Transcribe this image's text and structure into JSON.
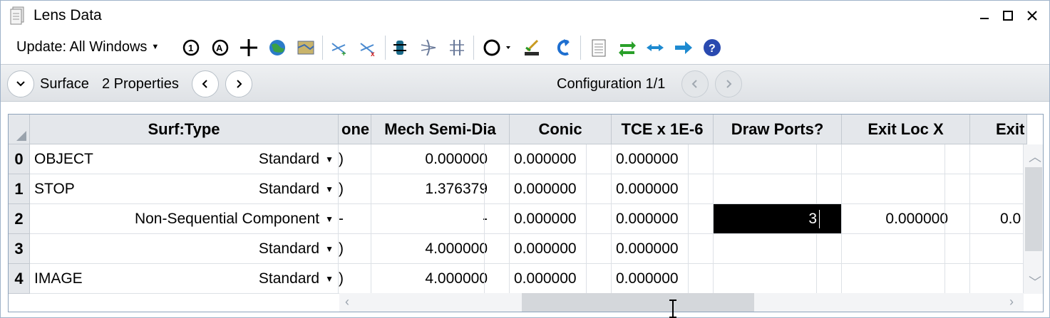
{
  "window": {
    "title": "Lens Data"
  },
  "toolbar": {
    "update_label": "Update: All Windows",
    "icons": [
      "refresh-icon",
      "refresh-all-icon",
      "crosshair-icon",
      "globe-icon",
      "map-icon",
      "insert-surface-icon",
      "delete-surface-icon",
      "gear-link-icon",
      "lens-icon",
      "grid-lens-icon",
      "aperture-icon",
      "paint-icon",
      "undo-icon",
      "document-icon",
      "swap-icon",
      "expand-icon",
      "arrow-right-icon",
      "help-icon"
    ]
  },
  "nav": {
    "surface_label": "Surface",
    "properties_label": "2 Properties",
    "configuration_label": "Configuration 1/1"
  },
  "table": {
    "headers": {
      "surf_type": "Surf:Type",
      "partial": "one",
      "mech_semi_dia": "Mech Semi-Dia",
      "conic": "Conic",
      "tce": "TCE x 1E-6",
      "draw_ports": "Draw Ports?",
      "exit_loc_x": "Exit Loc X",
      "exit_partial": "Exit"
    },
    "rows": [
      {
        "num": "0",
        "comment": "OBJECT",
        "type": "Standard",
        "partial": ")",
        "mech": "0.000000",
        "conic": "0.000000",
        "tce": "0.000000",
        "draw_ports": "",
        "exit_x": "",
        "exit_y": ""
      },
      {
        "num": "1",
        "comment": "STOP",
        "type": "Standard",
        "partial": ")",
        "mech": "1.376379",
        "conic": "0.000000",
        "tce": "0.000000",
        "draw_ports": "",
        "exit_x": "",
        "exit_y": ""
      },
      {
        "num": "2",
        "comment": "",
        "type": "Non-Sequential Component",
        "partial": "-",
        "mech": "-",
        "conic": "0.000000",
        "tce": "0.000000",
        "draw_ports": "3",
        "exit_x": "0.000000",
        "exit_y": "0.0"
      },
      {
        "num": "3",
        "comment": "",
        "type": "Standard",
        "partial": ")",
        "mech": "4.000000",
        "conic": "0.000000",
        "tce": "0.000000",
        "draw_ports": "",
        "exit_x": "",
        "exit_y": ""
      },
      {
        "num": "4",
        "comment": "IMAGE",
        "type": "Standard",
        "partial": ")",
        "mech": "4.000000",
        "conic": "0.000000",
        "tce": "0.000000",
        "draw_ports": "",
        "exit_x": "",
        "exit_y": ""
      }
    ]
  },
  "colors": {
    "selected_cell": "#000000",
    "header_bg": "#e4e7eb",
    "accent_blue": "#1e6fd0"
  }
}
